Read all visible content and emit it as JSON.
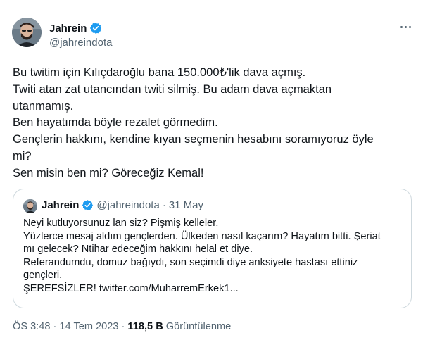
{
  "author": {
    "name": "Jahrein",
    "handle": "@jahreindota",
    "verified": true,
    "verified_color": "#1d9bf0"
  },
  "tweet_lines": [
    "Bu twitim için Kılıçdaroğlu bana 150.000₺'lik dava açmış.",
    "Twiti atan zat utancından twiti silmiş. Bu adam dava açmaktan",
    "utanmamış.",
    "Ben hayatımda böyle rezalet görmedim.",
    "Gençlerin hakkını, kendine kıyan seçmenin hesabını soramıyoruz öyle",
    "mi?",
    "Sen misin ben mi? Göreceğiz Kemal!"
  ],
  "quote": {
    "name": "Jahrein",
    "handle": "@jahreindota",
    "separator": "·",
    "date": "31 May",
    "lines": [
      "Neyi kutluyorsunuz lan siz? Pişmiş kelleler.",
      "Yüzlerce mesaj aldım gençlerden. Ülkeden nasıl kaçarım? Hayatım bitti. Şeriat",
      "mı gelecek? Ntihar edeceğim hakkını helal et diye.",
      "Referandumdu, domuz bağıydı, son seçimdi diye anksiyete hastası ettiniz",
      "gençleri.",
      "ŞEREFSİZLER! twitter.com/MuharremErkek1..."
    ]
  },
  "footer": {
    "time": "ÖS 3:48",
    "separator": "·",
    "date": "14 Tem 2023",
    "views_count": "118,5 B",
    "views_label": "Görüntülenme"
  },
  "icons": {
    "more": "more-icon",
    "verified": "verified-badge-icon"
  }
}
